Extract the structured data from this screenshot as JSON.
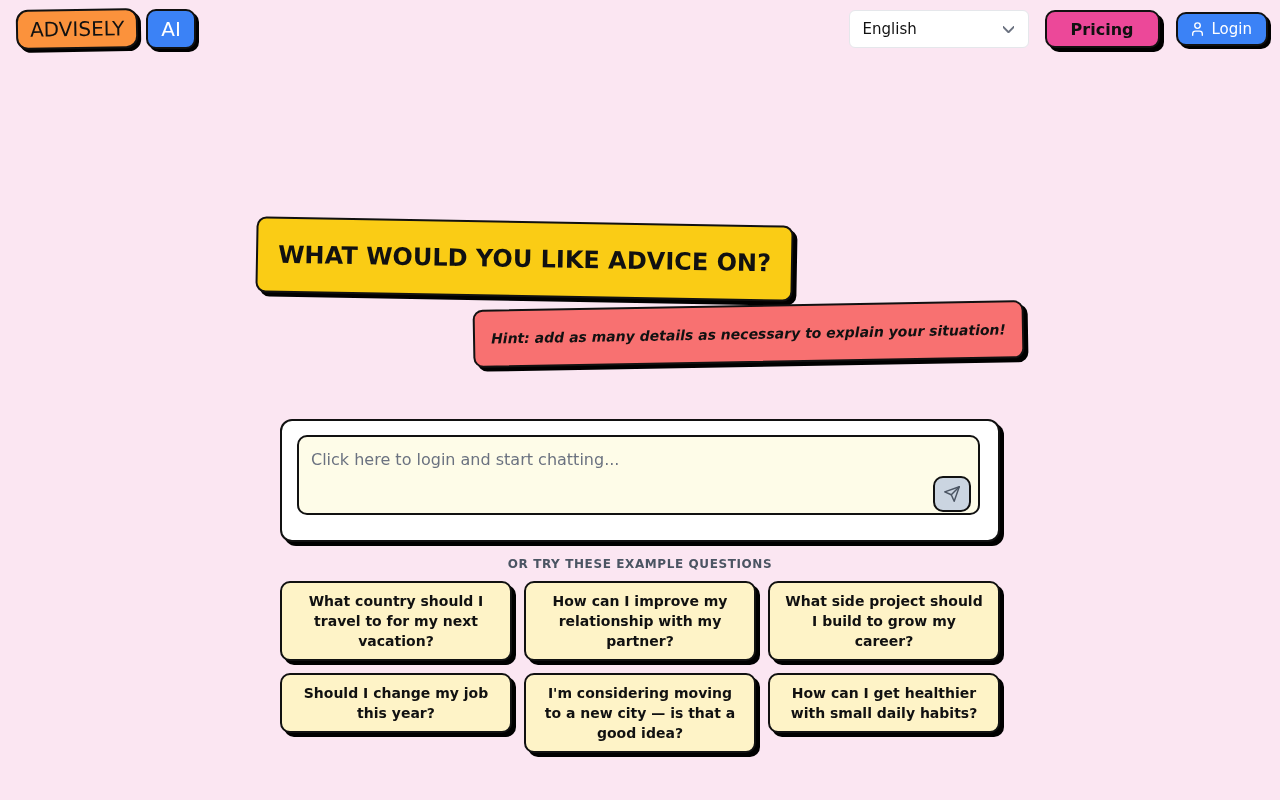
{
  "header": {
    "logo": {
      "name": "ADVISELY",
      "badge": "AI"
    },
    "language_select": {
      "value": "English"
    },
    "pricing_button": "Pricing",
    "login_button": "Login"
  },
  "hero": {
    "title": "WHAT WOULD YOU LIKE ADVICE ON?",
    "hint": "Hint: add as many details as necessary to explain your situation!"
  },
  "chat": {
    "placeholder": "Click here to login and start chatting...",
    "send_button": {
      "disabled": true
    }
  },
  "examples": {
    "heading": "OR TRY THESE EXAMPLE QUESTIONS",
    "questions": [
      "What country should I travel to for my next vacation?",
      "How can I improve my relationship with my partner?",
      "What side project should I build to grow my career?",
      "Should I change my job this year?",
      "I'm considering moving to a new city — is that a good idea?",
      "How can I get healthier with small daily habits?"
    ]
  }
}
